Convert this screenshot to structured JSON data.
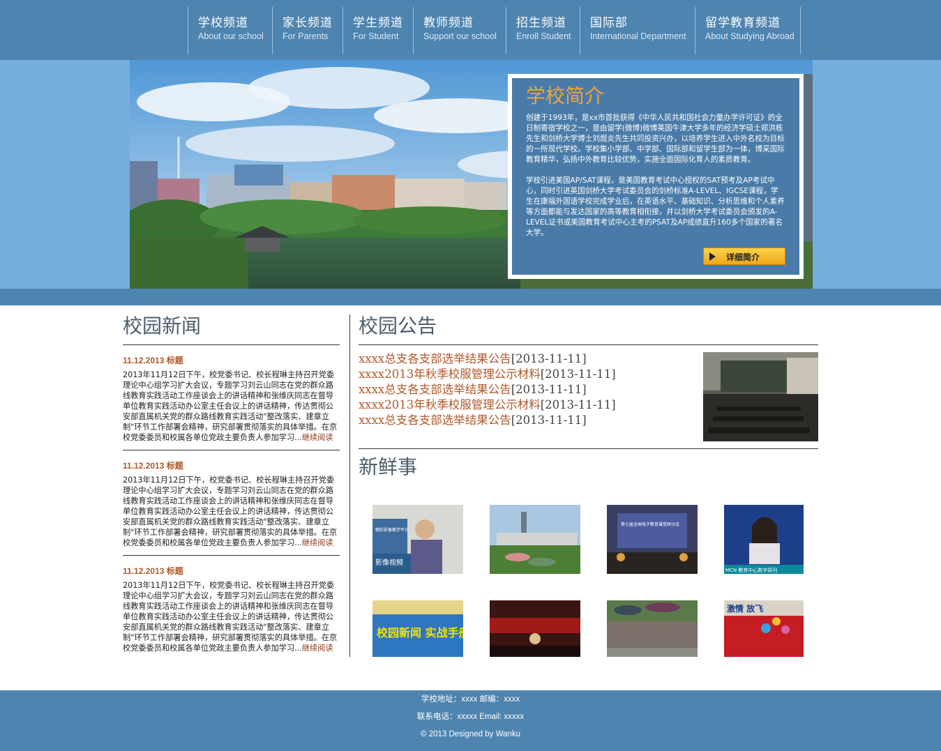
{
  "nav": [
    {
      "cn": "学校频道",
      "en": "About our school"
    },
    {
      "cn": "家长频道",
      "en": "For Parents"
    },
    {
      "cn": "学生频道",
      "en": "For Student"
    },
    {
      "cn": "教师频道",
      "en": "Support our school"
    },
    {
      "cn": "招生频道",
      "en": "Enroll Student"
    },
    {
      "cn": "国际部",
      "en": "International Department"
    },
    {
      "cn": "留学教育频道",
      "en": "About Studying Abroad"
    }
  ],
  "intro": {
    "title": "学校简介",
    "p1": "创建于1993年，是xx市首批获得《中华人民共和国社会力量办学许可证》的全日制寄宿学校之一，是由留学(微博)微博英国牛津大学多年的经济学硕士郑洪栋先生和剑桥大学博士刘煜炎先生共同投资兴办，以培养学生进入中外名校为目标的一所现代学校。学校集小学部、中学部、国际部和留学生部为一体，博采国际教育精华，弘扬中外教育比较优势，实施全面国际化育人的素质教育。",
    "p2": "学校引进美国AP/SAT课程，是美国教育考试中心授权的SAT预考及AP考试中心，同时引进英国剑桥大学考试委员会的剑桥标准A-LEVEL、IGCSE课程，学生在康福外国语学校完成学业后，在英语水平、基础知识、分析思维和个人素养等方面都能与发达国家的高等教育相衔接，并以剑桥大学考试委员会颁发的A-LEVEL证书或美国教育考试中心主考的PSAT及AP成绩直升160多个国家的著名大学。",
    "button": "详细简介"
  },
  "news": {
    "title": "校园新闻",
    "items": [
      {
        "date": "11.12.2013 标题",
        "body": "2013年11月12日下午，校党委书记、校长程琳主持召开党委理论中心组学习扩大会议，专题学习刘云山同志在党的群众路线教育实践活动工作座谈会上的讲话精神和张维庆同志在督导单位教育实践活动办公室主任会议上的讲话精神，传达贯彻公安部直属机关党的群众路线教育实践活动\"整改落实、建章立制\"环节工作部署会精神，研究部署贯彻落实的具体举措。在京校党委委员和校属各单位党政主要负责人参加学习...",
        "more": "继续阅读"
      },
      {
        "date": "11.12.2013 标题",
        "body": "2013年11月12日下午，校党委书记、校长程琳主持召开党委理论中心组学习扩大会议，专题学习刘云山同志在党的群众路线教育实践活动工作座谈会上的讲话精神和张维庆同志在督导单位教育实践活动办公室主任会议上的讲话精神，传达贯彻公安部直属机关党的群众路线教育实践活动\"整改落实、建章立制\"环节工作部署会精神，研究部署贯彻落实的具体举措。在京校党委委员和校属各单位党政主要负责人参加学习...",
        "more": "继续阅读"
      },
      {
        "date": "11.12.2013 标题",
        "body": "2013年11月12日下午，校党委书记、校长程琳主持召开党委理论中心组学习扩大会议，专题学习刘云山同志在党的群众路线教育实践活动工作座谈会上的讲话精神和张维庆同志在督导单位教育实践活动办公室主任会议上的讲话精神，传达贯彻公安部直属机关党的群众路线教育实践活动\"整改落实、建章立制\"环节工作部署会精神，研究部署贯彻落实的具体举措。在京校党委委员和校属各单位党政主要负责人参加学习...",
        "more": "继续阅读"
      }
    ]
  },
  "notices": {
    "title": "校园公告",
    "items": [
      {
        "text": "xxxx总支各支部选举结果公告",
        "date": "[2013-11-11]"
      },
      {
        "text": "xxxx2013年秋季校服管理公示材料",
        "date": "[2013-11-11]"
      },
      {
        "text": "xxxx总支各支部选举结果公告",
        "date": "[2013-11-11]"
      },
      {
        "text": "xxxx2013年秋季校服管理公示材料",
        "date": "[2013-11-11]"
      },
      {
        "text": "xxxx总支各支部选举结果公告",
        "date": "[2013-11-11]"
      }
    ]
  },
  "fresh": {
    "title": "新鲜事",
    "thumbs": [
      {
        "caption": "精彩影像教学平台",
        "label": "影像视频"
      },
      {
        "caption": "",
        "label": ""
      },
      {
        "caption": "第七届全国电子教育课堂研讨会",
        "label": ""
      },
      {
        "caption": "",
        "label": "MCN 教育中心数字周刊"
      },
      {
        "caption": "",
        "label": "校园新闻 实战手册"
      },
      {
        "caption": "",
        "label": ""
      },
      {
        "caption": "",
        "label": ""
      },
      {
        "caption": "",
        "label": "激情 放飞"
      }
    ]
  },
  "footer": {
    "line1": "学校地址：xxxx   邮编：xxxx",
    "line2": "联系电话：xxxxx Email: xxxxx",
    "line3": "© 2013   Designed by Wanku"
  }
}
